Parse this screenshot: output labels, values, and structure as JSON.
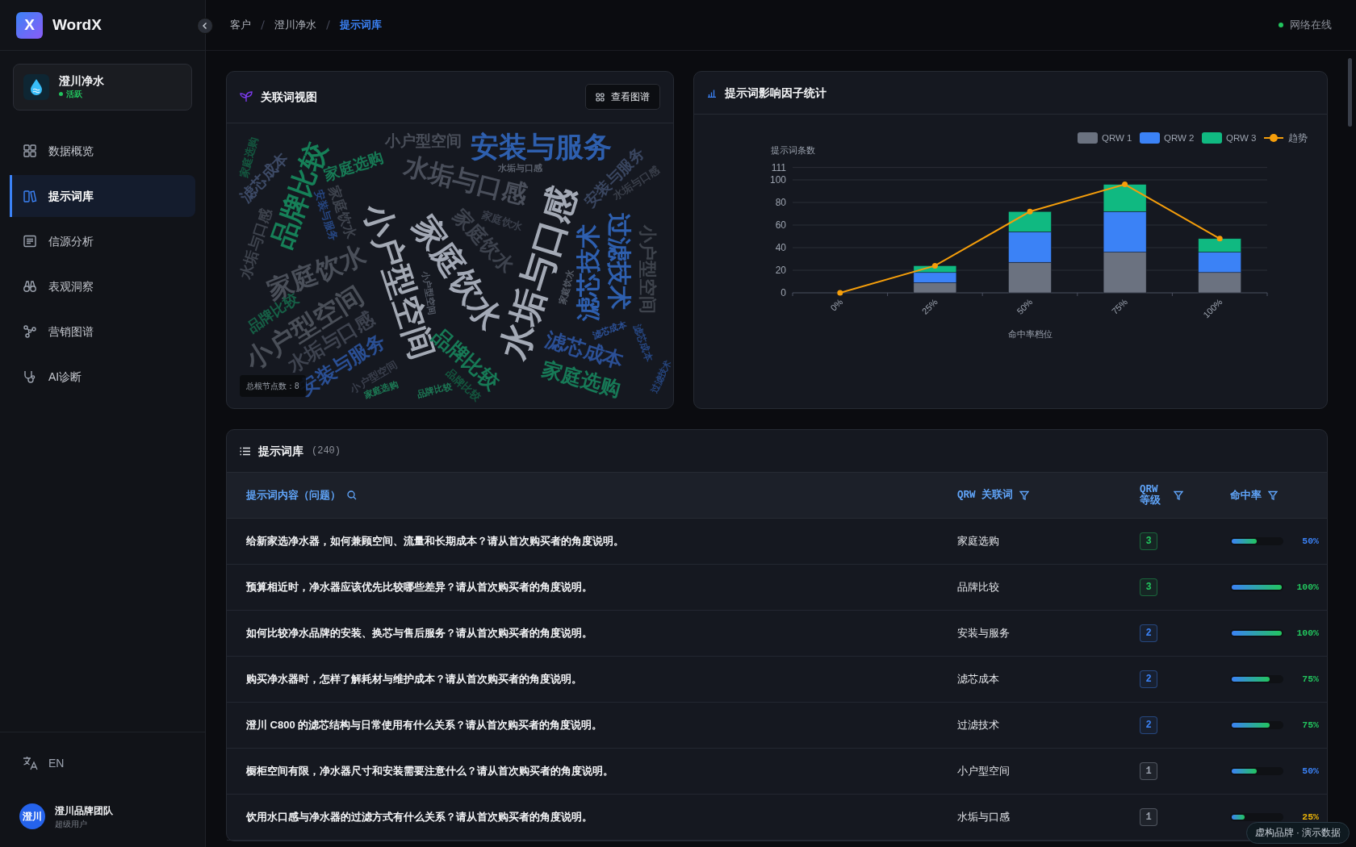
{
  "sidebar": {
    "brand": {
      "logo": "X",
      "name": "WordX"
    },
    "client": {
      "name": "澄川净水",
      "status": "活跃"
    },
    "nav": [
      {
        "label": "数据概览",
        "selected": false
      },
      {
        "label": "提示词库",
        "selected": true
      },
      {
        "label": "信源分析",
        "selected": false
      },
      {
        "label": "表观洞察",
        "selected": false
      },
      {
        "label": "营销图谱",
        "selected": false
      },
      {
        "label": "AI诊断",
        "selected": false
      }
    ],
    "language": "EN",
    "user": {
      "avatar": "澄川",
      "name": "澄川品牌团队",
      "role": "超级用户"
    }
  },
  "topbar": {
    "breadcrumb": [
      {
        "label": "客户",
        "selected": false
      },
      {
        "label": "澄川净水",
        "selected": false
      },
      {
        "label": "提示词库",
        "selected": true
      }
    ],
    "status": "网络在线"
  },
  "cloud_card": {
    "title": "关联词视图",
    "button": "查看图谱",
    "node_count": "总根节点数：8",
    "words": [
      {
        "text": "小户型空间",
        "color": "#4a4f5a"
      },
      {
        "text": "安装与服务",
        "color": "#2e5fae"
      },
      {
        "text": "家庭选购",
        "color": "#14573f"
      },
      {
        "text": "家庭选购",
        "color": "#177a55"
      },
      {
        "text": "水垢与口感",
        "color": "#5a606c"
      },
      {
        "text": "滤芯成本",
        "color": "#3d4a66"
      },
      {
        "text": "安装与服务",
        "color": "#3a4660"
      },
      {
        "text": "水垢与口感",
        "color": "#4a4f5b"
      },
      {
        "text": "水垢与口感",
        "color": "#3a3f4a"
      },
      {
        "text": "品牌比较",
        "color": "#168058"
      },
      {
        "text": "家庭饮水",
        "color": "#3e434d"
      },
      {
        "text": "安装与服务",
        "color": "#26457f"
      },
      {
        "text": "家庭饮水",
        "color": "#3a3f4b"
      },
      {
        "text": "家庭饮水",
        "color": "#3e434e"
      },
      {
        "text": "水垢与口感",
        "color": "#3e434d"
      },
      {
        "text": "过滤技术",
        "color": "#2e5fae"
      },
      {
        "text": "小户型空间",
        "color": "#3e434c"
      },
      {
        "text": "家庭饮水",
        "color": "#4a4f59"
      },
      {
        "text": "家庭饮水",
        "color": "#a3a9b6"
      },
      {
        "text": "水垢与口感",
        "color": "#a3a9b5"
      },
      {
        "text": "滤芯技术",
        "color": "#2e5faf"
      },
      {
        "text": "小户型空间",
        "color": "#a3a9b4"
      },
      {
        "text": "家庭饮水",
        "color": "#555b66"
      },
      {
        "text": "小户型空间",
        "color": "#555b67"
      },
      {
        "text": "品牌比较",
        "color": "#166046"
      },
      {
        "text": "小户型空间",
        "color": "#4a4f58"
      },
      {
        "text": "滤芯成本",
        "color": "#2c5095"
      },
      {
        "text": "水垢与口感",
        "color": "#3e434f"
      },
      {
        "text": "滤芯成本",
        "color": "#26457e"
      },
      {
        "text": "滤芯成本",
        "color": "#2b4f95"
      },
      {
        "text": "品牌比较",
        "color": "#177a56"
      },
      {
        "text": "安装与服务",
        "color": "#2a4f94"
      },
      {
        "text": "过滤技术",
        "color": "#26457d"
      },
      {
        "text": "小户型空间",
        "color": "#3a3f4c"
      },
      {
        "text": "家庭选购",
        "color": "#177a57"
      },
      {
        "text": "品牌比较",
        "color": "#14573e"
      },
      {
        "text": "家庭选购",
        "color": "#1d7a55"
      },
      {
        "text": "品牌比较",
        "color": "#1d7a56"
      }
    ]
  },
  "chart_card": {
    "title": "提示词影响因子统计",
    "chart_data": {
      "type": "bar",
      "stacked": true,
      "grid": true,
      "legend": true,
      "xlabel": "命中率档位",
      "ylabel": "提示词条数",
      "categories": [
        "0%",
        "25%",
        "50%",
        "75%",
        "100%"
      ],
      "ylim": [
        0,
        111
      ],
      "yticks": [
        0,
        20,
        40,
        60,
        80,
        100,
        111
      ],
      "series": [
        {
          "name": "QRW 1",
          "color": "#6b7280",
          "values": [
            0,
            9,
            27,
            36,
            18
          ]
        },
        {
          "name": "QRW 2",
          "color": "#3b82f6",
          "values": [
            0,
            9,
            27,
            36,
            18
          ]
        },
        {
          "name": "QRW 3",
          "color": "#10b981",
          "values": [
            0,
            6,
            18,
            24,
            12
          ]
        },
        {
          "name": "趋势",
          "color": "#f59e0b",
          "type": "line",
          "marker": true,
          "values": [
            0,
            24,
            72,
            96,
            48
          ]
        }
      ]
    }
  },
  "table_card": {
    "title": "提示词库",
    "count": "(240)",
    "columns": [
      {
        "label": "提示词内容（问题）"
      },
      {
        "label": "QRW 关联词"
      },
      {
        "label": "QRW 等级"
      },
      {
        "label": "命中率"
      }
    ],
    "rows": [
      {
        "question": "给新家选净水器，如何兼顾空间、流量和长期成本？请从首次购买者的角度说明。",
        "keyword": "家庭选购",
        "grade": "3",
        "color": "#22c55e",
        "rate": "50%",
        "level": 0.5
      },
      {
        "question": "预算相近时，净水器应该优先比较哪些差异？请从首次购买者的角度说明。",
        "keyword": "品牌比较",
        "grade": "3",
        "color": "#22c55e",
        "rate": "100%",
        "level": 1
      },
      {
        "question": "如何比较净水品牌的安装、换芯与售后服务？请从首次购买者的角度说明。",
        "keyword": "安装与服务",
        "grade": "2",
        "color": "#3b82f6",
        "rate": "100%",
        "level": 1
      },
      {
        "question": "购买净水器时，怎样了解耗材与维护成本？请从首次购买者的角度说明。",
        "keyword": "滤芯成本",
        "grade": "2",
        "color": "#3b82f7",
        "rate": "75%",
        "level": 0.75
      },
      {
        "question": "澄川 C800 的滤芯结构与日常使用有什么关系？请从首次购买者的角度说明。",
        "keyword": "过滤技术",
        "grade": "2",
        "color": "#3b82f5",
        "rate": "75%",
        "level": 0.75
      },
      {
        "question": "橱柜空间有限，净水器尺寸和安装需要注意什么？请从首次购买者的角度说明。",
        "keyword": "小户型空间",
        "grade": "1",
        "color": "#9ca3af",
        "rate": "50%",
        "level": 0.5
      },
      {
        "question": "饮用水口感与净水器的过滤方式有什么关系？请从首次购买者的角度说明。",
        "keyword": "水垢与口感",
        "grade": "1",
        "color": "#9ca3ae",
        "rate": "25%",
        "level": 0.25
      }
    ]
  },
  "demo_badge": "虚构品牌 · 演示数据"
}
